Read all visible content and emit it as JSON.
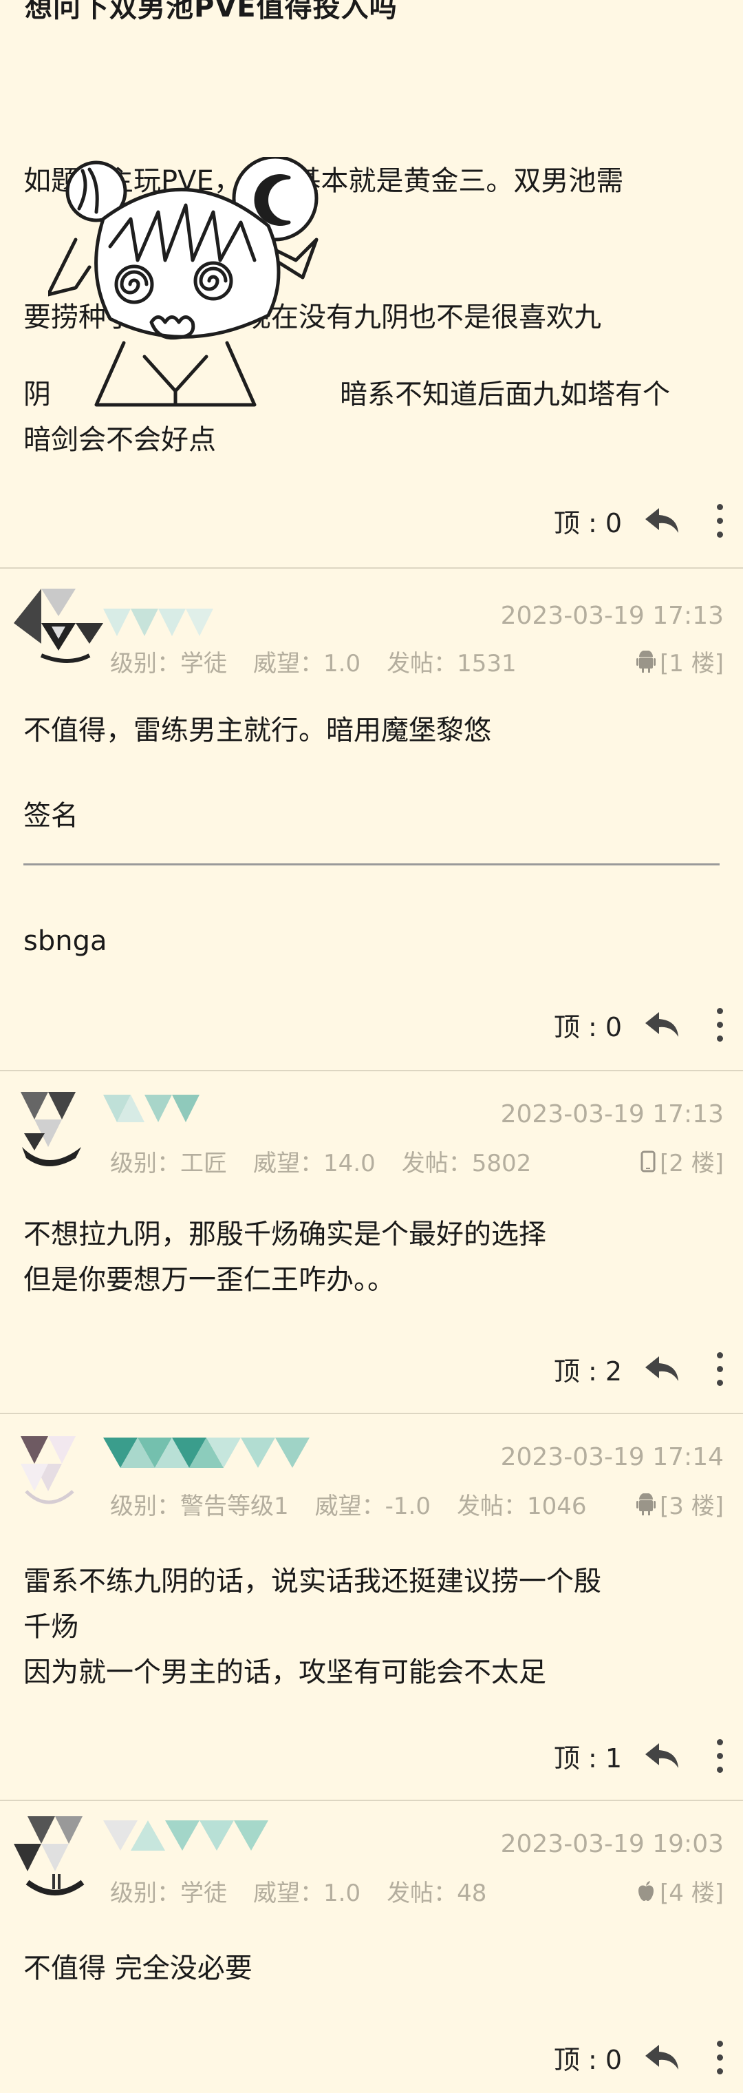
{
  "thread": {
    "title": "想问下双男池PVE值得投入吗",
    "body_line1": "如题，主玩PVE，PVP基本就是黄金三。双男池需",
    "body_line2": "要捞种子吗？雷系现在没有九阴也不是很喜欢九",
    "body_left_char": "阴",
    "body_right_text": "暗系不知道后面九如塔有个",
    "body_line4": "暗剑会不会好点",
    "ding_label": "顶 : 0"
  },
  "replies": [
    {
      "time": "2023-03-19 17:13",
      "level": "级别：学徒",
      "reputation": "威望：1.0",
      "posts": "发帖：1531",
      "floor": "[1 楼]",
      "device_icon": "android-icon",
      "text": "不值得，雷练男主就行。暗用魔堡黎悠",
      "signature_label": "签名",
      "signature_text": "sbnga",
      "ding_label": "顶 : 0"
    },
    {
      "time": "2023-03-19 17:13",
      "level": "级别：工匠",
      "reputation": "威望：14.0",
      "posts": "发帖：5802",
      "floor": "[2 楼]",
      "device_icon": "phone-icon",
      "text": "不想拉九阴，那殷千炀确实是个最好的选择\n但是你要想万一歪仁王咋办。。",
      "ding_label": "顶 : 2"
    },
    {
      "time": "2023-03-19 17:14",
      "level": "级别：警告等级1",
      "reputation": "威望：-1.0",
      "posts": "发帖：1046",
      "floor": "[3 楼]",
      "device_icon": "android-icon",
      "text": "雷系不练九阴的话，说实话我还挺建议捞一个殷\n千炀\n因为就一个男主的话，攻坚有可能会不太足",
      "ding_label": "顶 : 1"
    },
    {
      "time": "2023-03-19 19:03",
      "level": "级别：学徒",
      "reputation": "威望：1.0",
      "posts": "发帖：48",
      "floor": "[4 楼]",
      "device_icon": "apple-icon",
      "text": "不值得 完全没必要",
      "ding_label": "顶 : 0"
    }
  ],
  "colors": {
    "background": "#fff8e4",
    "meta_text": "#b4ae9e",
    "divider": "#ddd6c2",
    "avatar_teal": "#3a9d8c"
  }
}
